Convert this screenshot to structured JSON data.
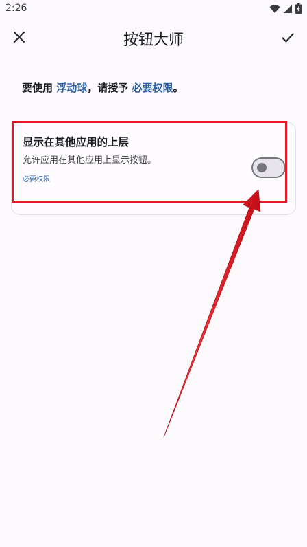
{
  "status_bar": {
    "time": "2:26",
    "icons": [
      "wifi-icon",
      "signal-icon",
      "battery-charging-icon"
    ]
  },
  "app_bar": {
    "title": "按钮大师",
    "close_icon": "close-icon",
    "confirm_icon": "check-icon"
  },
  "prompt": {
    "prefix": "要使用 ",
    "feature": "浮动球",
    "middle": "，请授予 ",
    "permission": "必要权限",
    "suffix": "。"
  },
  "permission_card": {
    "title": "显示在其他应用的上层",
    "description": "允许应用在其他应用上显示按钮。",
    "tag": "必要权限",
    "toggle_on": false
  },
  "colors": {
    "background": "#fcf9fd",
    "link": "#2d5fa3",
    "annotation": "#e01b24",
    "toggle_outline": "#77757c"
  }
}
